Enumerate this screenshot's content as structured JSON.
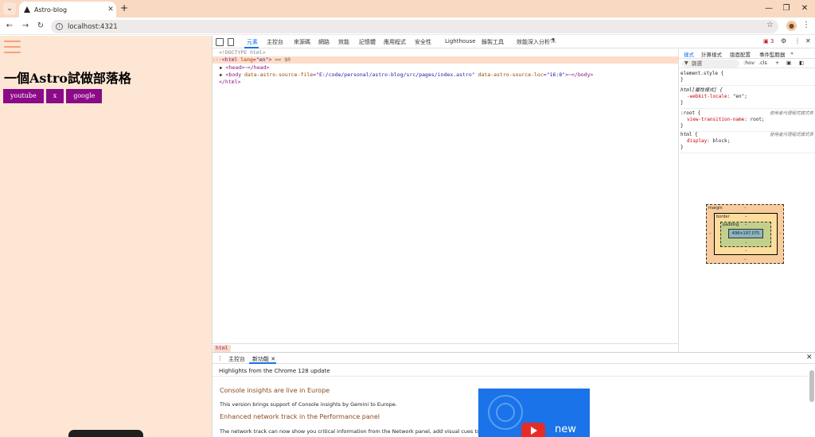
{
  "browser": {
    "tab_title": "Astro-blog",
    "url": "localhost:4321",
    "window_controls": [
      "⌄",
      "—",
      "❐",
      "✕"
    ]
  },
  "page": {
    "title": "一個Astro試做部落格",
    "links": [
      "youtube",
      "x",
      "google"
    ],
    "colors": {
      "background": "#fde6d3",
      "link_bg": "#8b0a87",
      "hamburger": "#f4a07a"
    }
  },
  "devtools": {
    "tabs": [
      "元素",
      "主控台",
      "來源碼",
      "網路",
      "效能",
      "記憶體",
      "應用程式",
      "安全性",
      "Lighthouse",
      "錄製工具",
      "效能深入分析"
    ],
    "active_tab": "元素",
    "issues_count": "3",
    "elements": {
      "doctype": "<!DOCTYPE html>",
      "html_open_tag": "html",
      "html_lang_attr": "lang",
      "html_lang_val": "\"en\"",
      "html_marker": "== $0",
      "head_tag": "head",
      "body_tag": "body",
      "body_attr1": "data-astro-source-file",
      "body_val1": "\"E:/code/personal/astro-blog/src/pages/index.astro\"",
      "body_attr2": "data-astro-source-loc",
      "body_val2": "\"16:8\"",
      "html_close": "</html>"
    },
    "breadcrumb": "html",
    "styles": {
      "tabs": [
        "樣式",
        "計算樣式",
        "版面配置",
        "事件監聽器"
      ],
      "filter_placeholder": "篩選",
      "filter_tools": [
        ":hov",
        ".cls",
        "+"
      ],
      "rules": [
        {
          "selector": "element.style {",
          "source": "",
          "props": []
        },
        {
          "selector": "html[屬性樣式] {",
          "source": "",
          "props": [
            {
              "name": "-webkit-locale",
              "value": "\"en\";"
            }
          ]
        },
        {
          "selector": ":root {",
          "source": "使用者代理程式樣式表",
          "props": [
            {
              "name": "view-transition-name",
              "value": "root;"
            }
          ]
        },
        {
          "selector": "html {",
          "source": "使用者代理程式樣式表",
          "props": [
            {
              "name": "display",
              "value": "block;"
            }
          ]
        }
      ],
      "box_model": {
        "margin": "margin",
        "border": "border",
        "padding": "padding",
        "dash": "–",
        "content_size": "498×197.075"
      }
    },
    "drawer": {
      "tabs": [
        "主控台",
        "新功能"
      ],
      "active_tab": "新功能",
      "highlights": "Highlights from the Chrome 128 update",
      "section1_title": "Console insights are live in Europe",
      "section1_text": "This version brings support of Console insights by Gemini to Europe.",
      "section2_title": "Enhanced network track in the Performance panel",
      "section2_text": "The network track can now show you critical information from the Network panel, add visual cues to",
      "video_label": "new"
    }
  }
}
